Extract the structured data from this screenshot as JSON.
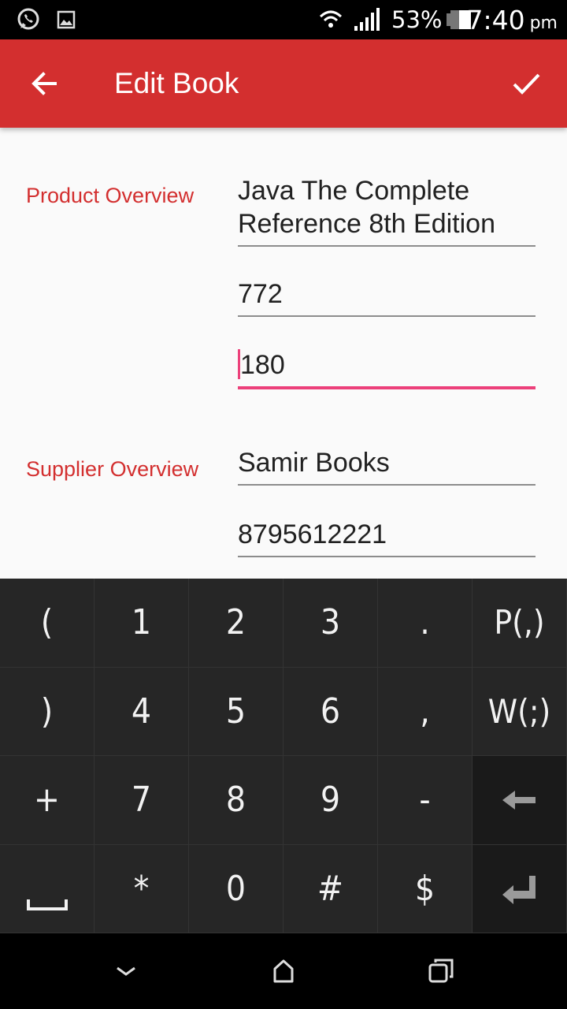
{
  "status_bar": {
    "battery_percent": "53%",
    "time": "7:40",
    "ampm": "pm",
    "icons": [
      "whatsapp-icon",
      "image-icon",
      "wifi-icon",
      "signal-icon",
      "battery-icon"
    ]
  },
  "app_bar": {
    "title": "Edit Book",
    "back_icon": "arrow-back-icon",
    "save_icon": "check-icon",
    "color": "#d32f2f"
  },
  "form": {
    "product_label": "Product Overview",
    "product_name": "Java The Complete Reference 8th Edition",
    "product_name_line1": "Java The Complete",
    "product_name_line2": "Reference 8th Edition",
    "price": "772",
    "quantity": "180",
    "supplier_label": "Supplier Overview",
    "supplier_name": "Samir Books",
    "supplier_phone": "8795612221"
  },
  "keyboard": {
    "rows": [
      [
        "(",
        "1",
        "2",
        "3",
        ".",
        "P(,)"
      ],
      [
        ")",
        "4",
        "5",
        "6",
        ",",
        "W(;)"
      ],
      [
        "+",
        "7",
        "8",
        "9",
        "-",
        "backspace-icon"
      ],
      [
        "space-icon",
        "*",
        "0",
        "#",
        "$",
        "enter-icon"
      ]
    ]
  },
  "nav_bar": {
    "icons": [
      "chevron-down-icon",
      "home-icon",
      "recents-icon"
    ]
  }
}
